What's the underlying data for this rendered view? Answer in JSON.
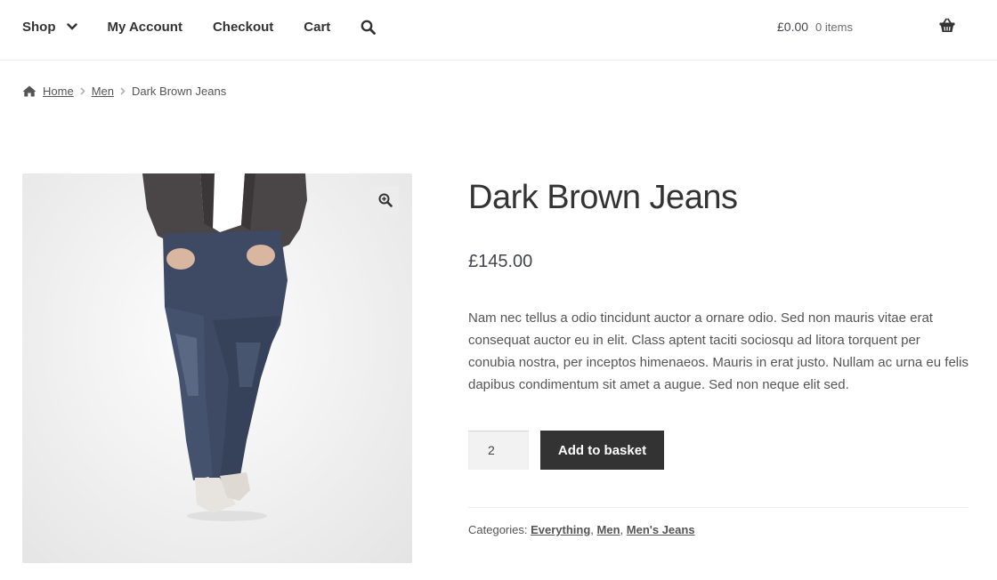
{
  "header": {
    "nav": [
      {
        "label": "Shop"
      },
      {
        "label": "My Account"
      },
      {
        "label": "Checkout"
      },
      {
        "label": "Cart"
      }
    ],
    "cart": {
      "amount": "£0.00",
      "count": "0 items"
    }
  },
  "breadcrumb": {
    "items": [
      {
        "label": "Home"
      },
      {
        "label": "Men"
      }
    ],
    "current": "Dark Brown Jeans"
  },
  "product": {
    "title": "Dark Brown Jeans",
    "price": "£145.00",
    "description": "Nam nec tellus a odio tincidunt auctor a ornare odio. Sed non mauris vitae erat consequat auctor eu in elit. Class aptent taciti sociosqu ad litora torquent per conubia nostra, per inceptos himenaeos. Mauris in erat justo. Nullam ac urna eu felis dapibus condimentum sit amet a augue. Sed non neque elit sed.",
    "quantity": "2",
    "add_to_basket_label": "Add to basket",
    "categories_label": "Categories:",
    "categories": [
      "Everything",
      "Men",
      "Men's Jeans"
    ],
    "image_icon": "zoom-in-icon"
  },
  "colors": {
    "accent_button": "#333333",
    "text": "#333333",
    "muted": "#555555"
  }
}
